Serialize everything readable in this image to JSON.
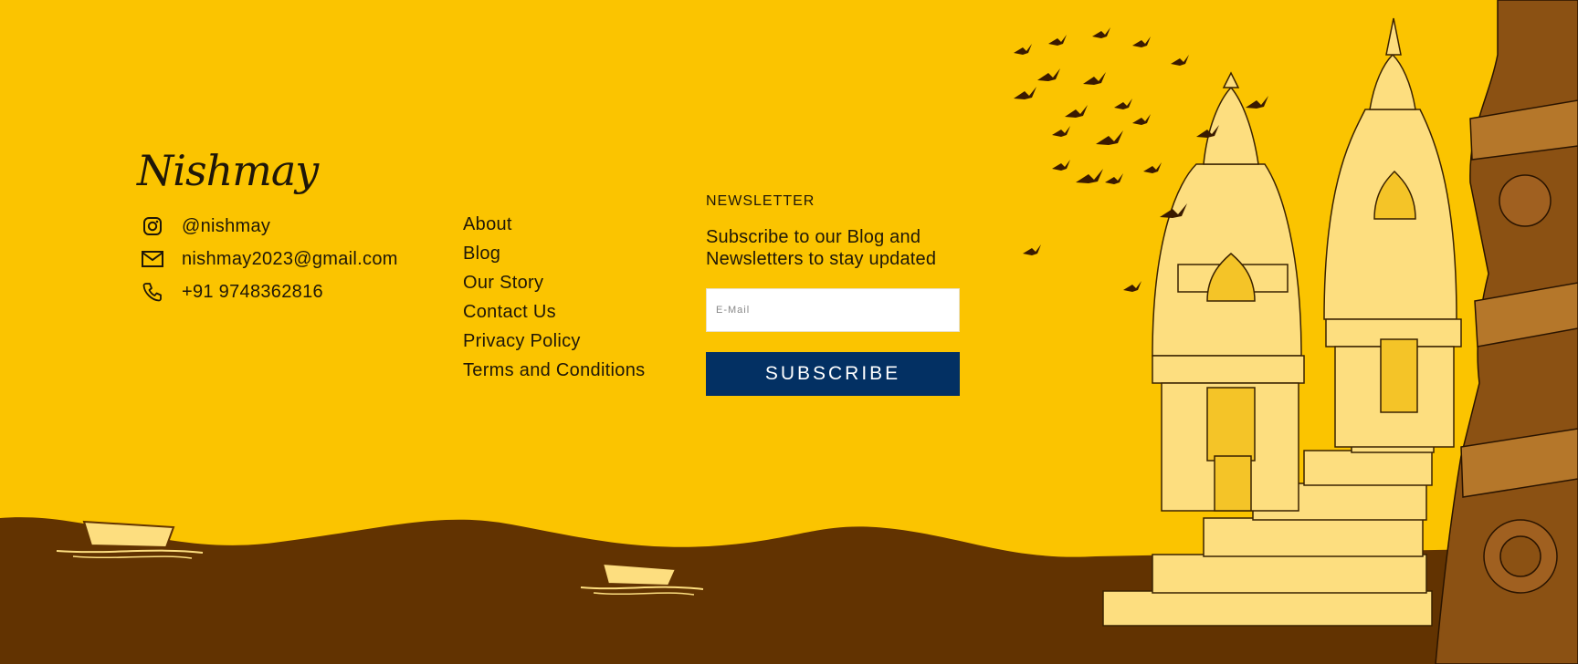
{
  "brand": {
    "logo": "Nishmay"
  },
  "contact": {
    "instagram": "@nishmay",
    "email": "nishmay2023@gmail.com",
    "phone": "+91 9748362816"
  },
  "links": [
    "About",
    "Blog",
    "Our Story",
    "Contact Us",
    "Privacy Policy",
    "Terms and Conditions"
  ],
  "newsletter": {
    "title": "NEWSLETTER",
    "text_line1": "Subscribe to our Blog and",
    "text_line2": "Newsletters to stay updated",
    "email_placeholder": "E-Mail",
    "button": "SUBSCRIBE"
  },
  "colors": {
    "background": "#FBC400",
    "river": "#623301",
    "button": "#033063",
    "text": "#1F1708",
    "temple": "#FDDE7F"
  },
  "icons": [
    "instagram-icon",
    "mail-icon",
    "phone-icon"
  ]
}
